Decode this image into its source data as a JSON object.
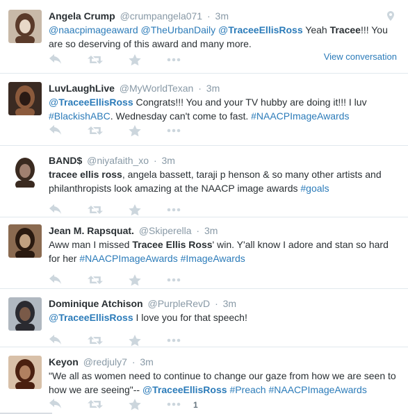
{
  "tweets": [
    {
      "fullname": "Angela Crump",
      "username": "@crumpangela071",
      "time": "3m",
      "parts": [
        {
          "t": "@naacpimageaward",
          "s": "link"
        },
        {
          "t": " ",
          "s": "plain"
        },
        {
          "t": "@TheUrbanDaily",
          "s": "link"
        },
        {
          "t": " ",
          "s": "plain"
        },
        {
          "t": "@",
          "s": "link"
        },
        {
          "t": "TraceeEllisRoss",
          "s": "link-bold"
        },
        {
          "t": " Yeah ",
          "s": "plain"
        },
        {
          "t": "Tracee",
          "s": "bold"
        },
        {
          "t": "!!! You are so deserving of this award and many more.",
          "s": "plain"
        }
      ],
      "view_conversation": "View conversation",
      "geo_icon": "map-pin-icon",
      "avatar_colors": [
        "#c8b9a8",
        "#5a3a2a",
        "#e8d8c8"
      ]
    },
    {
      "fullname": "LuvLaughLive",
      "username": "@MyWorldTexan",
      "time": "3m",
      "parts": [
        {
          "t": "@",
          "s": "link"
        },
        {
          "t": "TraceeEllisRoss",
          "s": "link-bold"
        },
        {
          "t": " Congrats!!!  You and your TV hubby are doing it!!!  I luv ",
          "s": "plain"
        },
        {
          "t": "#BlackishABC",
          "s": "link"
        },
        {
          "t": ".  Wednesday can't come to fast.  ",
          "s": "plain"
        },
        {
          "t": "#NAACPImageAwards",
          "s": "link"
        }
      ],
      "avatar_colors": [
        "#3a2a22",
        "#8b5a3c",
        "#2a1a14"
      ]
    },
    {
      "fullname": "BAND$",
      "username": "@niyafaith_xo",
      "time": "3m",
      "parts": [
        {
          "t": "tracee ellis ross",
          "s": "bold"
        },
        {
          "t": ", angela bassett, taraji p henson & so many other artists and philanthropists look amazing at the NAACP image awards ",
          "s": "plain"
        },
        {
          "t": "#goals",
          "s": "link"
        }
      ],
      "avatar_colors": [
        "#ffffff",
        "#3a2a20",
        "#a08070"
      ]
    },
    {
      "fullname": "Jean M. Rapsquat.",
      "username": "@Skiperella",
      "time": "3m",
      "parts": [
        {
          "t": "Aww man I missed ",
          "s": "plain"
        },
        {
          "t": "Tracee Ellis Ross",
          "s": "bold"
        },
        {
          "t": "' win. Y'all know I adore and stan so hard for her ",
          "s": "plain"
        },
        {
          "t": "#NAACPImageAwards",
          "s": "link"
        },
        {
          "t": " ",
          "s": "plain"
        },
        {
          "t": "#ImageAwards",
          "s": "link"
        }
      ],
      "avatar_colors": [
        "#8a6a50",
        "#2a1a10",
        "#c0a080"
      ]
    },
    {
      "fullname": "Dominique Atchison",
      "username": "@PurpleRevD",
      "time": "3m",
      "parts": [
        {
          "t": "@",
          "s": "link"
        },
        {
          "t": "TraceeEllisRoss",
          "s": "link-bold"
        },
        {
          "t": " I love you for that speech!",
          "s": "plain"
        }
      ],
      "avatar_colors": [
        "#b0b8c0",
        "#2a2a30",
        "#7a5a48"
      ]
    },
    {
      "fullname": "Keyon",
      "username": "@redjuly7",
      "time": "3m",
      "parts": [
        {
          "t": "\"We all as women need to continue to change our gaze from how we are seen to how we are seeing\"-- ",
          "s": "plain"
        },
        {
          "t": "@",
          "s": "link"
        },
        {
          "t": "TraceeEllisRoss",
          "s": "link-bold"
        },
        {
          "t": " ",
          "s": "plain"
        },
        {
          "t": "#Preach",
          "s": "link"
        },
        {
          "t": " ",
          "s": "plain"
        },
        {
          "t": "#NAACPImageAwards",
          "s": "link"
        }
      ],
      "favorite_count": "1",
      "avatar_colors": [
        "#d8c0a8",
        "#4a2010",
        "#b08060"
      ]
    }
  ],
  "icons": {
    "reply": "reply-icon",
    "retweet": "retweet-icon",
    "favorite": "star-icon",
    "more": "more-icon"
  }
}
